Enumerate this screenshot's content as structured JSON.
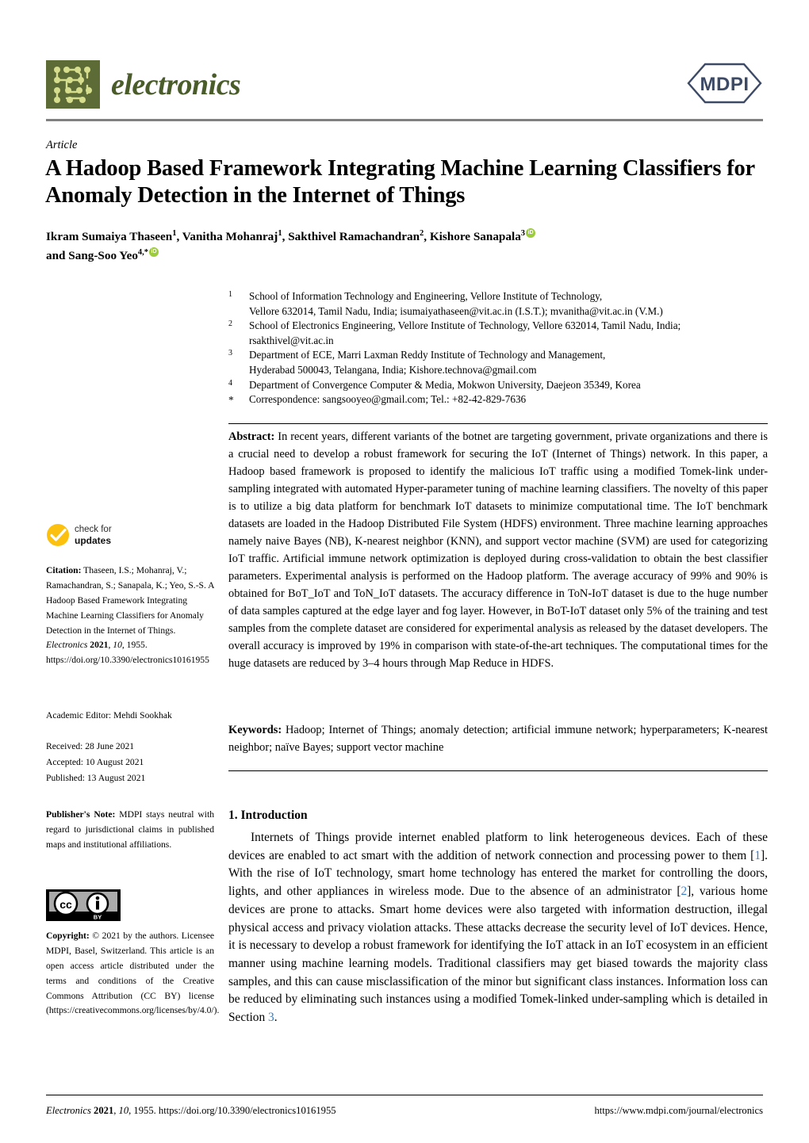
{
  "header": {
    "journal_name": "electronics",
    "publisher_logo_text": "MDPI"
  },
  "article": {
    "type_label": "Article",
    "title": "A Hadoop Based Framework Integrating Machine Learning Classifiers for Anomaly Detection in the Internet of Things",
    "authors_line1_a": "Ikram Sumaiya Thaseen",
    "authors_line1_a_sup": "1",
    "authors_line1_b": "Vanitha Mohanraj",
    "authors_line1_b_sup": "1",
    "authors_line1_c": "Sakthivel Ramachandran",
    "authors_line1_c_sup": "2",
    "authors_line1_d": "Kishore Sanapala",
    "authors_line1_d_sup": "3",
    "authors_line2_prefix": "and",
    "authors_line2_e": "Sang-Soo Yeo",
    "authors_line2_e_sup": "4,*"
  },
  "affiliations": [
    {
      "marker": "1",
      "lines": [
        "School of Information Technology and Engineering, Vellore Institute of Technology,",
        "Vellore 632014, Tamil Nadu, India; isumaiyathaseen@vit.ac.in (I.S.T.); mvanitha@vit.ac.in (V.M.)"
      ]
    },
    {
      "marker": "2",
      "lines": [
        "School of Electronics Engineering, Vellore Institute of Technology, Vellore 632014, Tamil Nadu, India;",
        "rsakthivel@vit.ac.in"
      ]
    },
    {
      "marker": "3",
      "lines": [
        "Department of ECE, Marri Laxman Reddy Institute of Technology and Management,",
        "Hyderabad 500043, Telangana, India; Kishore.technova@gmail.com"
      ]
    },
    {
      "marker": "4",
      "lines": [
        "Department of Convergence Computer & Media, Mokwon University, Daejeon 35349, Korea"
      ]
    },
    {
      "marker": "*",
      "lines": [
        "Correspondence: sangsooyeo@gmail.com; Tel.: +82-42-829-7636"
      ]
    }
  ],
  "abstract": {
    "label": "Abstract:",
    "text": " In recent years, different variants of the botnet are targeting government, private organizations and there is a crucial need to develop a robust framework for securing the IoT (Internet of Things) network. In this paper, a Hadoop based framework is proposed to identify the malicious IoT traffic using a modified Tomek-link under-sampling integrated with automated Hyper-parameter tuning of machine learning classifiers. The novelty of this paper is to utilize a big data platform for benchmark IoT datasets to minimize computational time. The IoT benchmark datasets are loaded in the Hadoop Distributed File System (HDFS) environment. Three machine learning approaches namely naive Bayes (NB), K-nearest neighbor (KNN), and support vector machine (SVM) are used for categorizing IoT traffic. Artificial immune network optimization is deployed during cross-validation to obtain the best classifier parameters. Experimental analysis is performed on the Hadoop platform. The average accuracy of 99% and 90% is obtained for BoT_IoT and ToN_IoT datasets. The accuracy difference in ToN-IoT dataset is due to the huge number of data samples captured at the edge layer and fog layer. However, in BoT-IoT dataset only 5% of the training and test samples from the complete dataset are considered for experimental analysis as released by the dataset developers. The overall accuracy is improved by 19% in comparison with state-of-the-art techniques. The computational times for the huge datasets are reduced by 3–4 hours through Map Reduce in HDFS."
  },
  "keywords": {
    "label": "Keywords:",
    "text": " Hadoop; Internet of Things; anomaly detection; artificial immune network; hyperparameters; K-nearest neighbor; naïve Bayes; support vector machine"
  },
  "sidebar": {
    "check_for_updates_line1": "check for",
    "check_for_updates_line2": "updates",
    "citation_label": "Citation:",
    "citation_authors": " Thaseen, I.S.; Mohanraj, V.; Ramachandran, S.; Sanapala, K.; Yeo, S.-S. A Hadoop Based Framework Integrating Machine Learning Classifiers for Anomaly Detection in the Internet of Things. ",
    "citation_journal": "Electronics",
    "citation_year": "2021",
    "citation_volume": "10",
    "citation_pages": ", 1955.  https://doi.org/10.3390/electronics10161955",
    "academic_editor": "Academic Editor: Mehdi Sookhak",
    "received": "Received: 28 June 2021",
    "accepted": "Accepted: 10 August 2021",
    "published": "Published: 13 August 2021",
    "publisher_note_label": "Publisher's Note:",
    "publisher_note_text": " MDPI stays neutral with regard to jurisdictional claims in published maps and institutional affiliations.",
    "license_badge_cc": "cc",
    "license_badge_by": "BY",
    "copyright_label": "Copyright:",
    "copyright_text": " © 2021 by the authors. Licensee MDPI, Basel, Switzerland. This article is an open access article distributed under the terms and conditions of the Creative Commons Attribution (CC BY) license (https://creativecommons.org/licenses/by/4.0/)."
  },
  "introduction": {
    "heading": "1. Introduction",
    "part1": "Internets of Things provide internet enabled platform to link heterogeneous devices. Each of these devices are enabled to act smart with the addition of network connection and processing power to them [",
    "ref1": "1",
    "part2": "]. With the rise of IoT technology, smart home technology has entered the market for controlling the doors, lights, and other appliances in wireless mode.  Due to the absence of an administrator [",
    "ref2": "2",
    "part3": "], various home devices are prone to attacks.  Smart home devices were also targeted with information destruction, illegal physical access and privacy violation attacks.  These attacks decrease the security level of IoT devices. Hence, it is necessary to develop a robust framework for identifying the IoT attack in an IoT ecosystem in an efficient manner using machine learning models. Traditional classifiers may get biased towards the majority class samples, and this can cause misclassification of the minor but significant class instances. Information loss can be reduced by eliminating such instances using a modified Tomek-linked under-sampling which is detailed in Section ",
    "ref3": "3",
    "part4": "."
  },
  "footer": {
    "journal": "Electronics",
    "year": "2021",
    "volume": "10",
    "rest": ", 1955. https://doi.org/10.3390/electronics10161955",
    "url": "https://www.mdpi.com/journal/electronics"
  },
  "colors": {
    "journal_green": "#4a5c2a",
    "logo_square": "#5d6b37",
    "logo_trace": "#d6de8e",
    "mdpi_navy": "#3d4a66",
    "orcid_green": "#9ccb3b",
    "check_yellow": "#fcc10f",
    "cite_blue": "#3b7ec4",
    "rule_gray": "#808080"
  }
}
